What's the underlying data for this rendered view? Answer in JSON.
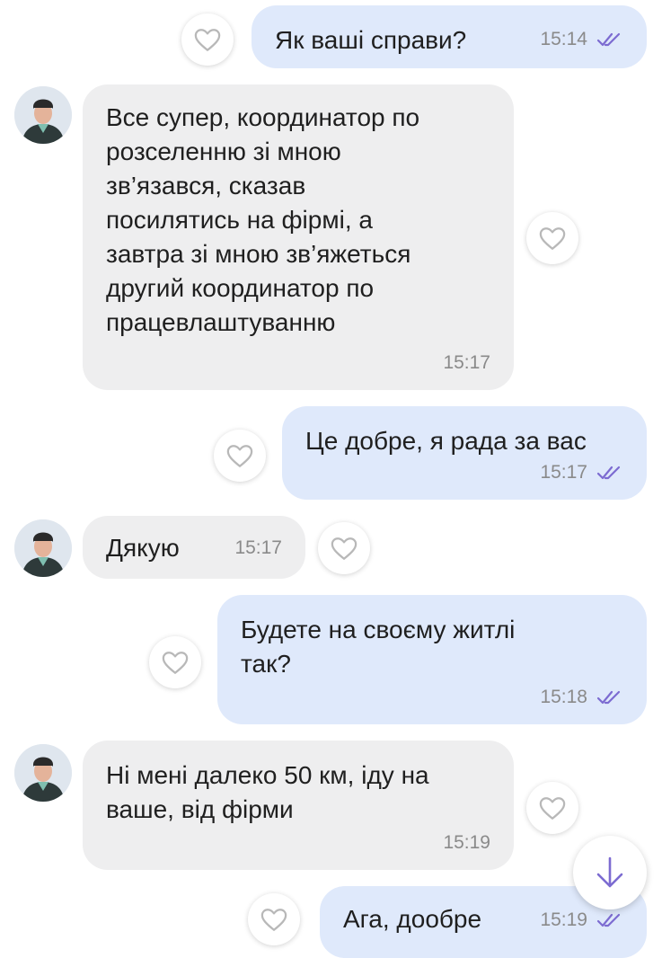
{
  "colors": {
    "outgoing_bubble": "#dfe9fb",
    "incoming_bubble": "#eeeeef",
    "accent_purple": "#7c6bd1",
    "timestamp": "#8a8a8a"
  },
  "messages": [
    {
      "direction": "outgoing",
      "text": "Як ваші справи?",
      "time": "15:14",
      "status_icon": "double-check-icon"
    },
    {
      "direction": "incoming",
      "text": "Все супер, координатор по\nрозселенню зі мною\nзв’язався, сказав\nпосилятись на фірмі, а\nзавтра зі мною зв’яжеться\nдругий координатор по\nпрацевлаштуванню",
      "time": "15:17"
    },
    {
      "direction": "outgoing",
      "text": "Це добре, я рада за вас",
      "time": "15:17",
      "status_icon": "double-check-icon"
    },
    {
      "direction": "incoming",
      "text": "Дякую",
      "time": "15:17"
    },
    {
      "direction": "outgoing",
      "text": "Будете на своєму житлі\nтак?",
      "time": "15:18",
      "status_icon": "double-check-icon"
    },
    {
      "direction": "incoming",
      "text": "Ні мені далеко 50 км, іду на\nваше, від фірми",
      "time": "15:19"
    },
    {
      "direction": "outgoing",
      "text": "Ага, дообре",
      "time": "15:19",
      "status_icon": "double-check-icon"
    }
  ],
  "icons": {
    "like": "heart-outline-icon",
    "scroll": "arrow-down-icon",
    "avatar": "contact-avatar"
  }
}
